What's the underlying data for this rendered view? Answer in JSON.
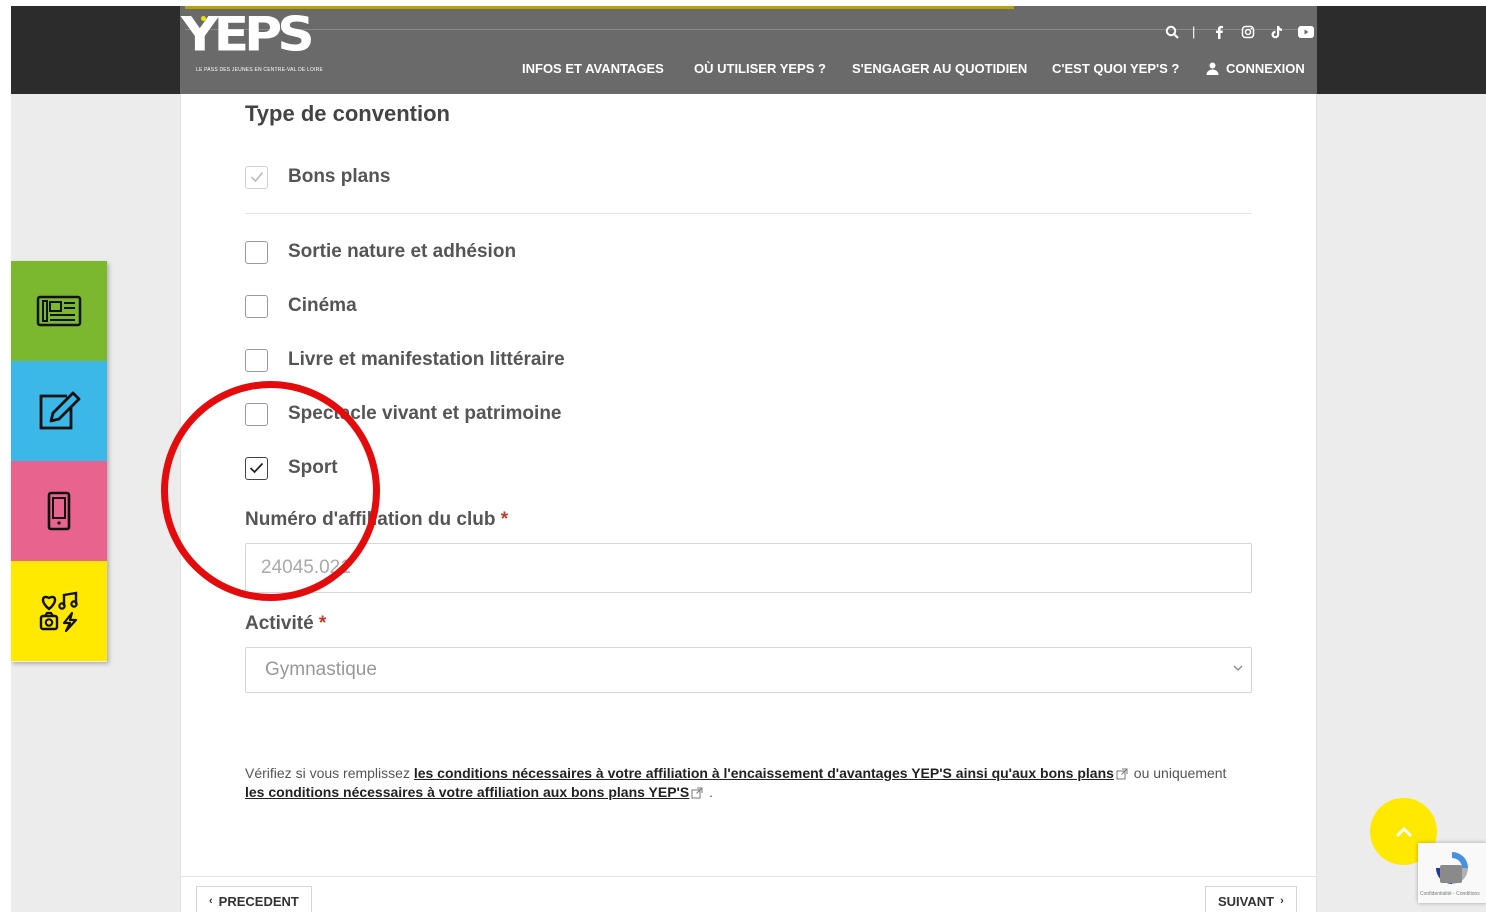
{
  "header": {
    "logo_text": "YEPS",
    "tagline": "LE PASS DES JEUNES EN CENTRE-VAL DE LOIRE",
    "social_icons": [
      "search-icon",
      "separator",
      "facebook-icon",
      "instagram-icon",
      "tiktok-icon",
      "youtube-icon"
    ],
    "separator": "|",
    "nav": {
      "infos": "INFOS ET AVANTAGES",
      "ou_utiliser": "OÙ UTILISER YEPS ?",
      "engager": "S'ENGAGER AU QUOTIDIEN",
      "cest_quoi": "C'EST QUOI YEP'S ?",
      "connexion": "CONNEXION"
    }
  },
  "form": {
    "section_title": "Type de convention",
    "options": [
      {
        "label": "Bons plans",
        "checked": true,
        "disabled": true
      },
      {
        "label": "Sortie nature et adhésion",
        "checked": false
      },
      {
        "label": "Cinéma",
        "checked": false
      },
      {
        "label": "Livre et manifestation littéraire",
        "checked": false
      },
      {
        "label": "Spectacle vivant et patrimoine",
        "checked": false
      },
      {
        "label": "Sport",
        "checked": true
      }
    ],
    "affiliation": {
      "label": "Numéro d'affiliation du club",
      "required_mark": "*",
      "value": "24045.021"
    },
    "activite": {
      "label": "Activité",
      "required_mark": "*",
      "value": "Gymnastique"
    },
    "verify": {
      "prefix": "Vérifiez si vous remplissez ",
      "link1": "les conditions nécessaires à votre affiliation à l'encaissement d'avantages YEP'S ainsi qu'aux bons plans",
      "middle": " ou uniquement ",
      "link2": "les conditions nécessaires à votre affiliation aux bons plans YEP'S",
      "suffix": " ."
    }
  },
  "footer": {
    "prev_label": "PRECEDENT",
    "next_label": "SUIVANT"
  },
  "side_menu": [
    {
      "icon": "newspaper-icon",
      "color": "#7cb82f"
    },
    {
      "icon": "edit-note-icon",
      "color": "#3bb8e8"
    },
    {
      "icon": "mobile-phone-icon",
      "color": "#e8648f"
    },
    {
      "icon": "leisure-activities-icon",
      "color": "#ffe900"
    }
  ],
  "recaptcha": {
    "text": "Confidentialité - Conditions"
  },
  "colors": {
    "header_bg": "#6a6a6a",
    "accent_yellow": "#ffe900",
    "required_red": "#c0392b",
    "annotation_red": "#e30b0b"
  }
}
